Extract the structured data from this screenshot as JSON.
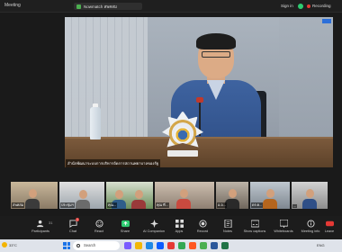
{
  "window": {
    "title": "Meeting",
    "speaker_pill": "Nowmatch สพคสม",
    "sign_in": "Sign in",
    "recording": "Recording"
  },
  "main_video": {
    "name_tag": "สำนักพัฒนาระบบการบริหารจัดการสถานพยาบาลของรัฐ"
  },
  "thumbnails": [
    {
      "caption": "สพคสม"
    },
    {
      "caption": "ประชุมฯ"
    },
    {
      "caption": "คุณ..."
    },
    {
      "caption": "คุณ ที่..."
    },
    {
      "caption": "อ.อ..."
    },
    {
      "caption": "ดร.ค..."
    },
    {
      "caption": "..."
    }
  ],
  "toolbar": {
    "participants": "Participants",
    "participants_count": "31",
    "chat": "Chat",
    "chat_badge": "1",
    "react": "React",
    "share": "Share",
    "ai_companion": "AI Companion",
    "apps": "Apps",
    "record": "Record",
    "notes": "Notes",
    "show_captions": "Show captions",
    "whiteboards": "Whiteboards",
    "meeting_info": "Meeting info",
    "leave": "Leave"
  },
  "taskbar": {
    "temp": "33°C",
    "search_placeholder": "Search",
    "lang": "ENG"
  },
  "colors": {
    "accent_green": "#2ecc71",
    "record_red": "#e53935",
    "zoom_blue": "#0b5cff"
  }
}
